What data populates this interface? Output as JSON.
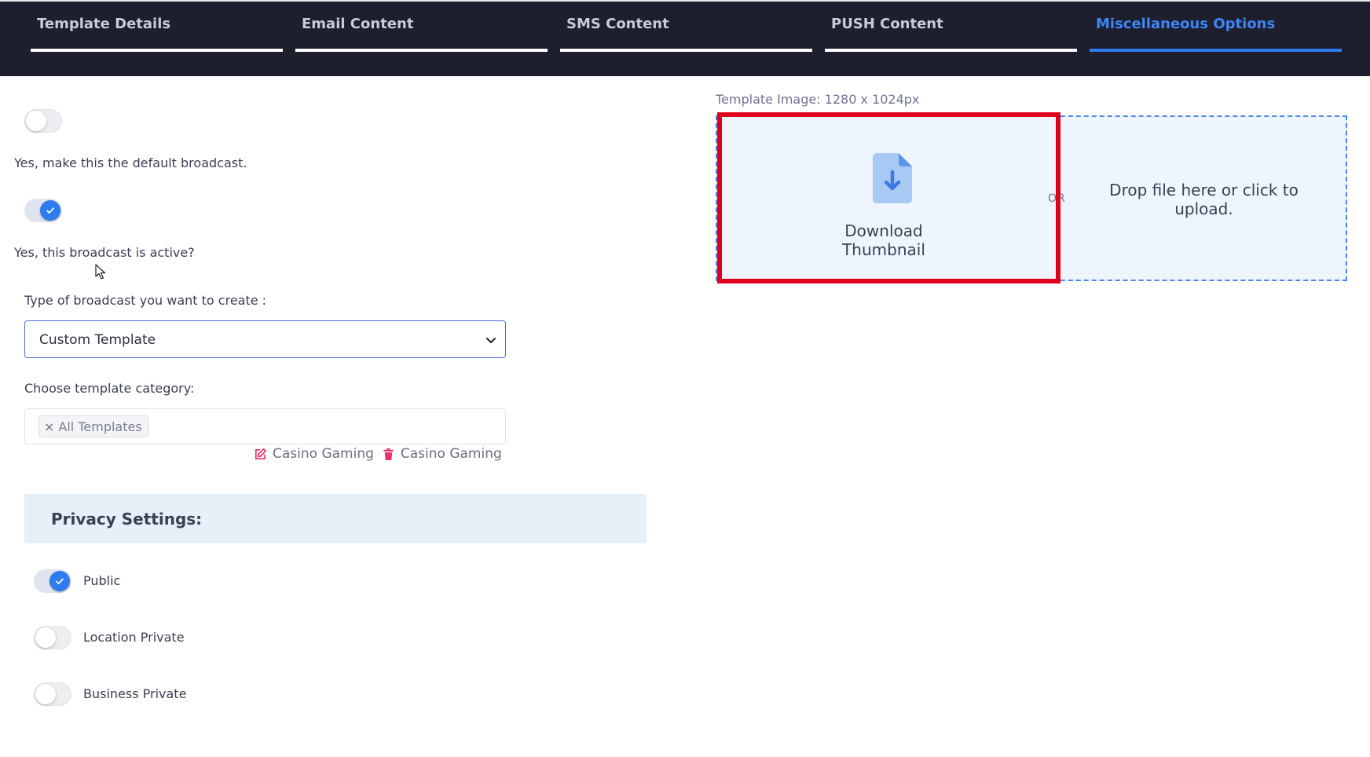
{
  "tabs": [
    {
      "label": "Template Details",
      "active": false
    },
    {
      "label": "Email Content",
      "active": false
    },
    {
      "label": "SMS Content",
      "active": false
    },
    {
      "label": "PUSH Content",
      "active": false
    },
    {
      "label": "Miscellaneous Options",
      "active": true
    }
  ],
  "settings": {
    "default_broadcast_label": "Yes, make this the default broadcast.",
    "default_broadcast_on": false,
    "active_label": "Yes, this broadcast is active?",
    "active_on": true
  },
  "broadcast_type": {
    "label": "Type of broadcast you want to create :",
    "selected": "Custom Template"
  },
  "template_category": {
    "label": "Choose template category:",
    "chips": [
      "All Templates"
    ],
    "chip_remove": "×",
    "edit_label": "Casino Gaming",
    "delete_label": "Casino Gaming"
  },
  "privacy": {
    "title": "Privacy Settings:",
    "options": [
      {
        "label": "Public",
        "on": true
      },
      {
        "label": "Location Private",
        "on": false
      },
      {
        "label": "Business Private",
        "on": false
      }
    ]
  },
  "upload": {
    "image_label": "Template Image: 1280 x 1024px",
    "download_label": "Download Thumbnail",
    "or_label": "OR",
    "drop_text": "Drop file here or click to upload."
  },
  "colors": {
    "tabbar_bg": "#1e1f2e",
    "accent": "#2f7bf0",
    "highlight": "#e0001b",
    "delete_icon": "#e8336a"
  }
}
